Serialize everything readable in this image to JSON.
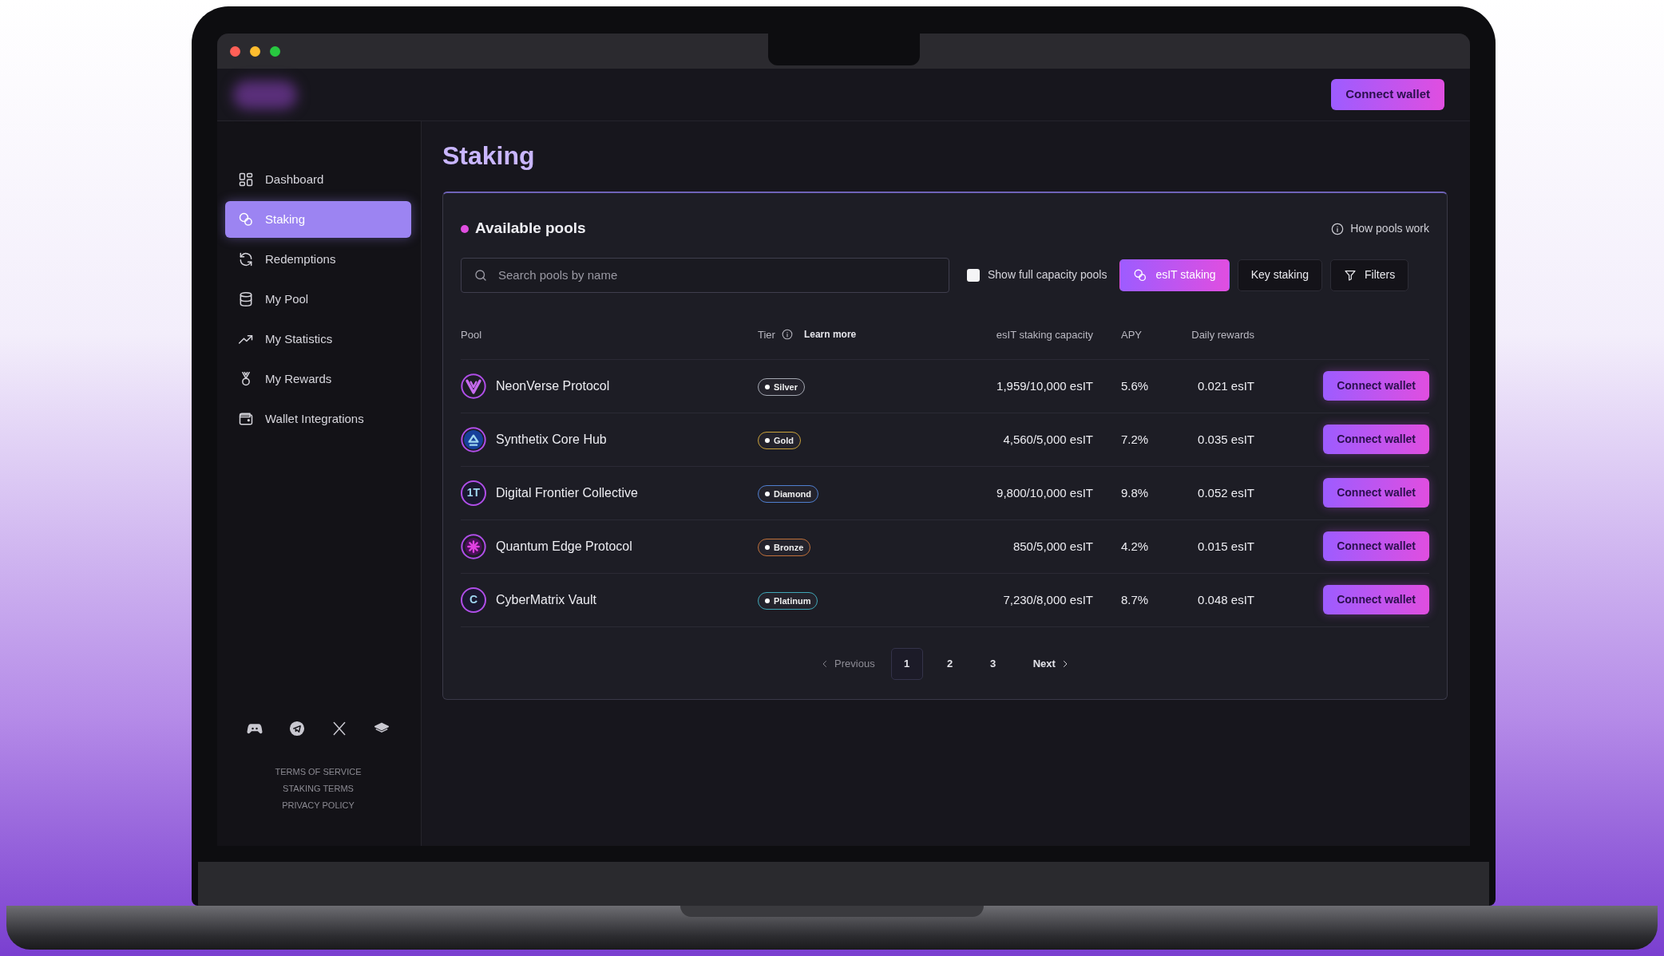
{
  "header": {
    "connect_button": "Connect wallet"
  },
  "sidebar": {
    "items": [
      {
        "label": "Dashboard",
        "selected": false
      },
      {
        "label": "Staking",
        "selected": true
      },
      {
        "label": "Redemptions",
        "selected": false
      },
      {
        "label": "My Pool",
        "selected": false
      },
      {
        "label": "My Statistics",
        "selected": false
      },
      {
        "label": "My Rewards",
        "selected": false
      },
      {
        "label": "Wallet Integrations",
        "selected": false
      }
    ],
    "footer_links": [
      "TERMS OF SERVICE",
      "STAKING TERMS",
      "PRIVACY POLICY"
    ]
  },
  "page_title": "Staking",
  "pools": {
    "title": "Available pools",
    "help_link": "How pools work",
    "search": {
      "placeholder": "Search pools by name"
    },
    "full_capacity": {
      "label": "Show full capacity pools",
      "checked": false
    },
    "staking_tabs": [
      {
        "label": "esIT staking",
        "selected": true
      },
      {
        "label": "Key staking",
        "selected": false
      }
    ],
    "filters_button": "Filters",
    "columns": [
      "Pool",
      "Tier",
      "esIT staking capacity",
      "APY",
      "Daily rewards"
    ],
    "tier_link": "Learn more",
    "rows": [
      {
        "name": "NeonVerse Protocol",
        "tier": {
          "label": "Silver",
          "color": "#a4a8b2"
        },
        "capacity": "1,959/10,000 esIT",
        "apy": "5.6%",
        "daily": "0.021 esIT",
        "action": "Connect wallet"
      },
      {
        "name": "Synthetix Core Hub",
        "tier": {
          "label": "Gold",
          "color": "#c9a13a"
        },
        "capacity": "4,560/5,000 esIT",
        "apy": "7.2%",
        "daily": "0.035 esIT",
        "action": "Connect wallet"
      },
      {
        "name": "Digital Frontier Collective",
        "logo_text": "1T",
        "tier": {
          "label": "Diamond",
          "color": "#4f7fd0"
        },
        "capacity": "9,800/10,000 esIT",
        "apy": "9.8%",
        "daily": "0.052 esIT",
        "action": "Connect wallet"
      },
      {
        "name": "Quantum Edge Protocol",
        "tier": {
          "label": "Bronze",
          "color": "#c0703a"
        },
        "capacity": "850/5,000 esIT",
        "apy": "4.2%",
        "daily": "0.015 esIT",
        "action": "Connect wallet"
      },
      {
        "name": "CyberMatrix Vault",
        "logo_text": "C",
        "tier": {
          "label": "Platinum",
          "color": "#3fa7b8"
        },
        "capacity": "7,230/8,000 esIT",
        "apy": "8.7%",
        "daily": "0.048 esIT",
        "action": "Connect wallet"
      }
    ],
    "pagination": {
      "previous": "Previous",
      "pages": [
        {
          "label": "1",
          "selected": true
        },
        {
          "label": "2",
          "selected": false
        },
        {
          "label": "3",
          "selected": false
        }
      ],
      "next": "Next"
    }
  }
}
